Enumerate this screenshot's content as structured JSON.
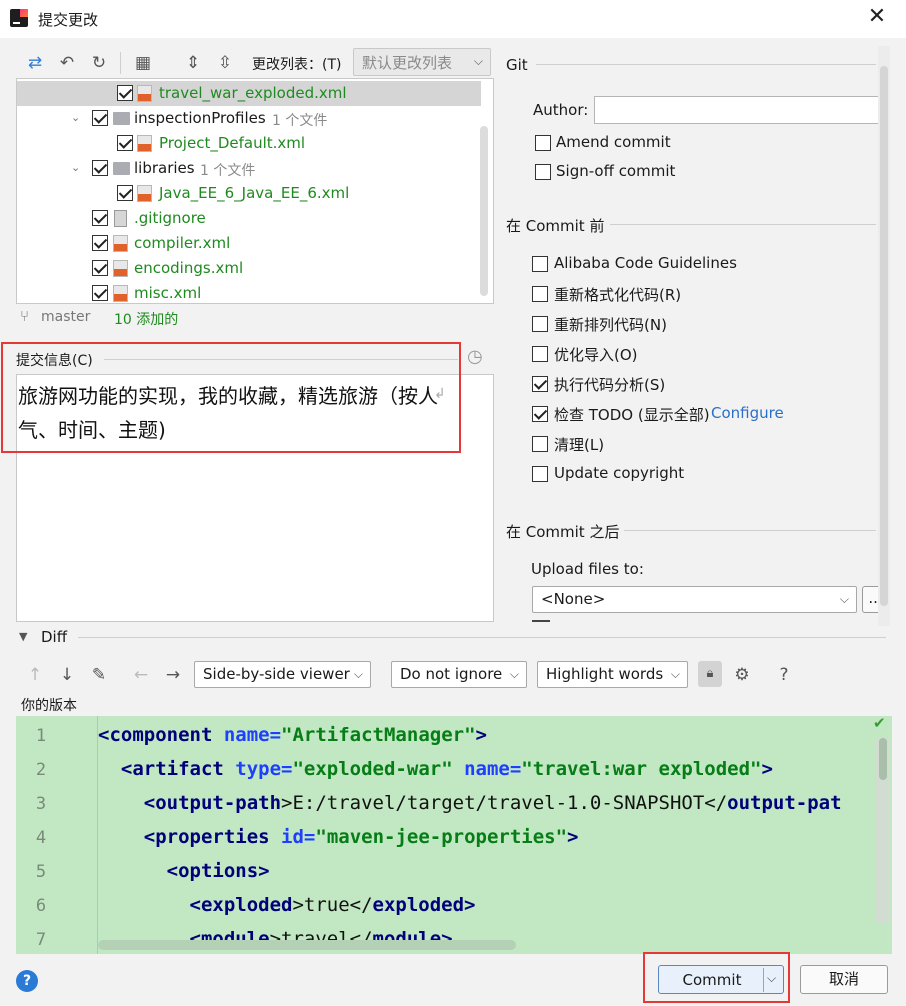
{
  "window": {
    "title": "提交更改",
    "close": "✕"
  },
  "toolbar": {
    "changelist_label": "更改列表：(T)",
    "changelist_value": "默认更改列表"
  },
  "tree": {
    "rows": [
      {
        "name": "travel_war_exploded.xml",
        "count": ""
      },
      {
        "name": "inspectionProfiles",
        "count": "1 个文件"
      },
      {
        "name": "Project_Default.xml",
        "count": ""
      },
      {
        "name": "libraries",
        "count": "1 个文件"
      },
      {
        "name": "Java_EE_6_Java_EE_6.xml",
        "count": ""
      },
      {
        "name": ".gitignore",
        "count": ""
      },
      {
        "name": "compiler.xml",
        "count": ""
      },
      {
        "name": "encodings.xml",
        "count": ""
      },
      {
        "name": "misc.xml",
        "count": ""
      }
    ]
  },
  "status": {
    "branch": "master",
    "added": "10 添加的"
  },
  "commit_message": {
    "label": "提交信息(C)",
    "text": "旅游网功能的实现，我的收藏，精选旅游（按人气、时间、主题)"
  },
  "git": {
    "section": "Git",
    "author_label": "Author:",
    "author_value": "",
    "amend": "Amend commit",
    "signoff": "Sign-off commit"
  },
  "before_commit": {
    "section": "在 Commit 前",
    "options": [
      {
        "label": "Alibaba Code Guidelines",
        "checked": false
      },
      {
        "label": "重新格式化代码(R)",
        "checked": false
      },
      {
        "label": "重新排列代码(N)",
        "checked": false
      },
      {
        "label": "优化导入(O)",
        "checked": false
      },
      {
        "label": "执行代码分析(S)",
        "checked": true
      },
      {
        "label": "检查 TODO (显示全部)",
        "checked": true
      },
      {
        "label": "清理(L)",
        "checked": false
      },
      {
        "label": "Update copyright",
        "checked": false
      }
    ],
    "configure": "Configure"
  },
  "after_commit": {
    "section": "在 Commit 之后",
    "upload_label": "Upload files to:",
    "upload_value": "<None>",
    "more": "..."
  },
  "diff": {
    "section": "Diff",
    "viewer": "Side-by-side viewer",
    "ignore": "Do not ignore",
    "highlight": "Highlight words",
    "question": "?",
    "version_label": "你的版本",
    "lines": [
      {
        "n": "1",
        "indent": "",
        "parts": [
          [
            "tag",
            "<component "
          ],
          [
            "attr",
            "name="
          ],
          [
            "val",
            "\"ArtifactManager\""
          ],
          [
            "tag",
            ">"
          ]
        ]
      },
      {
        "n": "2",
        "indent": "  ",
        "parts": [
          [
            "tag",
            "<artifact "
          ],
          [
            "attr",
            "type="
          ],
          [
            "val",
            "\"exploded-war\" "
          ],
          [
            "attr",
            "name="
          ],
          [
            "val",
            "\"travel:war exploded\""
          ],
          [
            "tag",
            ">"
          ]
        ]
      },
      {
        "n": "3",
        "indent": "    ",
        "parts": [
          [
            "tag",
            "<output-path"
          ],
          [
            "txt",
            ">E:/travel/target/travel-1.0-SNAPSHOT</"
          ],
          [
            "tag",
            "output-pat"
          ]
        ]
      },
      {
        "n": "4",
        "indent": "    ",
        "parts": [
          [
            "tag",
            "<properties "
          ],
          [
            "attr",
            "id="
          ],
          [
            "val",
            "\"maven-jee-properties\""
          ],
          [
            "tag",
            ">"
          ]
        ]
      },
      {
        "n": "5",
        "indent": "      ",
        "parts": [
          [
            "tag",
            "<options>"
          ]
        ]
      },
      {
        "n": "6",
        "indent": "        ",
        "parts": [
          [
            "tag",
            "<exploded"
          ],
          [
            "txt",
            ">true</"
          ],
          [
            "tag",
            "exploded>"
          ]
        ]
      },
      {
        "n": "7",
        "indent": "        ",
        "parts": [
          [
            "tag",
            "<module"
          ],
          [
            "txt",
            ">travel</"
          ],
          [
            "tag",
            "module>"
          ]
        ]
      }
    ]
  },
  "buttons": {
    "commit": "Commit",
    "cancel": "取消",
    "help": "?"
  }
}
